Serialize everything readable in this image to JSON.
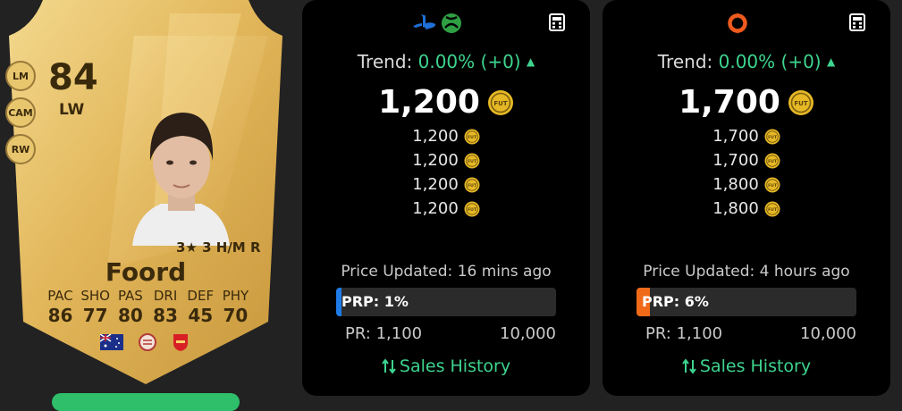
{
  "card": {
    "rating": "84",
    "position": "LW",
    "alt_positions": [
      "LM",
      "CAM",
      "RW"
    ],
    "skills_line": "3★ 3 H/M R",
    "name": "Foord",
    "stats": [
      {
        "label": "PAC",
        "value": "86"
      },
      {
        "label": "SHO",
        "value": "77"
      },
      {
        "label": "PAS",
        "value": "80"
      },
      {
        "label": "DRI",
        "value": "83"
      },
      {
        "label": "DEF",
        "value": "45"
      },
      {
        "label": "PHY",
        "value": "70"
      }
    ],
    "icons": [
      "australia-flag-icon",
      "league-badge-icon",
      "arsenal-club-icon"
    ]
  },
  "panels": [
    {
      "platform_icons": [
        "playstation-icon",
        "xbox-icon"
      ],
      "trend_label": "Trend:",
      "trend_value": "0.00% (+0)",
      "price": "1,200",
      "prices": [
        "1,200",
        "1,200",
        "1,200",
        "1,200"
      ],
      "updated": "Price Updated: 16 mins ago",
      "prp_label": "PRP: 1%",
      "prp_value": 1,
      "prp_color": "#1f7be8",
      "pr_min": "PR: 1,100",
      "pr_max": "10,000",
      "sales_label": "Sales History"
    },
    {
      "platform_icons": [
        "origin-pc-icon"
      ],
      "trend_label": "Trend:",
      "trend_value": "0.00% (+0)",
      "price": "1,700",
      "prices": [
        "1,700",
        "1,700",
        "1,800",
        "1,800"
      ],
      "updated": "Price Updated: 4 hours ago",
      "prp_label": "PRP: 6%",
      "prp_value": 6,
      "prp_color": "#f06a1a",
      "pr_min": "PR: 1,100",
      "pr_max": "10,000",
      "sales_label": "Sales History"
    }
  ],
  "colors": {
    "accent_green": "#3ed48f",
    "card_gold": "#e6bf63",
    "panel_bg": "#000000"
  }
}
